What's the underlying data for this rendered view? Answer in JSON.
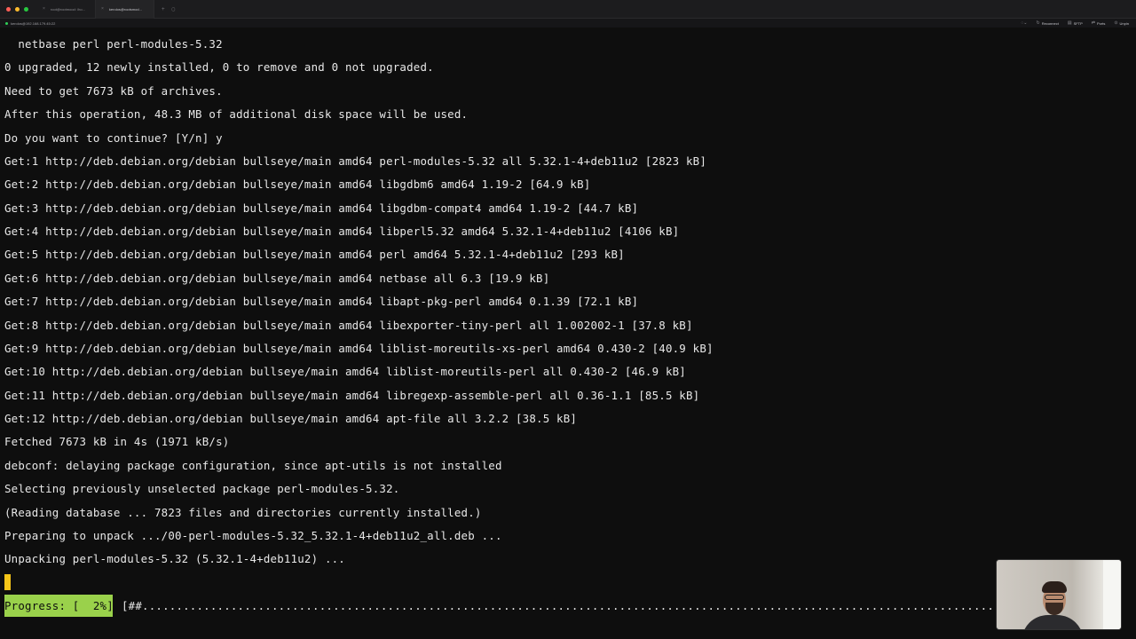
{
  "titlebar": {
    "tabs": [
      {
        "label": "root@rootmood: /ho...",
        "active": false
      },
      {
        "label": "kerolos@rootsmod...",
        "active": true
      }
    ]
  },
  "session": {
    "host": "kerolos@192.168.179.45:22",
    "actions": [
      {
        "icon": "reconnect-icon",
        "label": "Reconnect"
      },
      {
        "icon": "sftp-icon",
        "label": "SFTP"
      },
      {
        "icon": "ports-icon",
        "label": "Ports"
      },
      {
        "icon": "unpin-icon",
        "label": "Unpin"
      }
    ]
  },
  "terminal": {
    "lines": [
      "  netbase perl perl-modules-5.32",
      "0 upgraded, 12 newly installed, 0 to remove and 0 not upgraded.",
      "Need to get 7673 kB of archives.",
      "After this operation, 48.3 MB of additional disk space will be used.",
      "Do you want to continue? [Y/n] y",
      "Get:1 http://deb.debian.org/debian bullseye/main amd64 perl-modules-5.32 all 5.32.1-4+deb11u2 [2823 kB]",
      "Get:2 http://deb.debian.org/debian bullseye/main amd64 libgdbm6 amd64 1.19-2 [64.9 kB]",
      "Get:3 http://deb.debian.org/debian bullseye/main amd64 libgdbm-compat4 amd64 1.19-2 [44.7 kB]",
      "Get:4 http://deb.debian.org/debian bullseye/main amd64 libperl5.32 amd64 5.32.1-4+deb11u2 [4106 kB]",
      "Get:5 http://deb.debian.org/debian bullseye/main amd64 perl amd64 5.32.1-4+deb11u2 [293 kB]",
      "Get:6 http://deb.debian.org/debian bullseye/main amd64 netbase all 6.3 [19.9 kB]",
      "Get:7 http://deb.debian.org/debian bullseye/main amd64 libapt-pkg-perl amd64 0.1.39 [72.1 kB]",
      "Get:8 http://deb.debian.org/debian bullseye/main amd64 libexporter-tiny-perl all 1.002002-1 [37.8 kB]",
      "Get:9 http://deb.debian.org/debian bullseye/main amd64 liblist-moreutils-xs-perl amd64 0.430-2 [40.9 kB]",
      "Get:10 http://deb.debian.org/debian bullseye/main amd64 liblist-moreutils-perl all 0.430-2 [46.9 kB]",
      "Get:11 http://deb.debian.org/debian bullseye/main amd64 libregexp-assemble-perl all 0.36-1.1 [85.5 kB]",
      "Get:12 http://deb.debian.org/debian bullseye/main amd64 apt-file all 3.2.2 [38.5 kB]",
      "Fetched 7673 kB in 4s (1971 kB/s)",
      "debconf: delaying package configuration, since apt-utils is not installed",
      "Selecting previously unselected package perl-modules-5.32.",
      "(Reading database ... 7823 files and directories currently installed.)",
      "Preparing to unpack .../00-perl-modules-5.32_5.32.1-4+deb11u2_all.deb ...",
      "Unpacking perl-modules-5.32 (5.32.1-4+deb11u2) ..."
    ],
    "progress_label": "Progress: [  2%]",
    "progress_bar": "[##...............................................................................................................................................",
    "progress_percent": 2,
    "cursor_color": "#f5c518",
    "progress_color": "#9ad14b"
  }
}
